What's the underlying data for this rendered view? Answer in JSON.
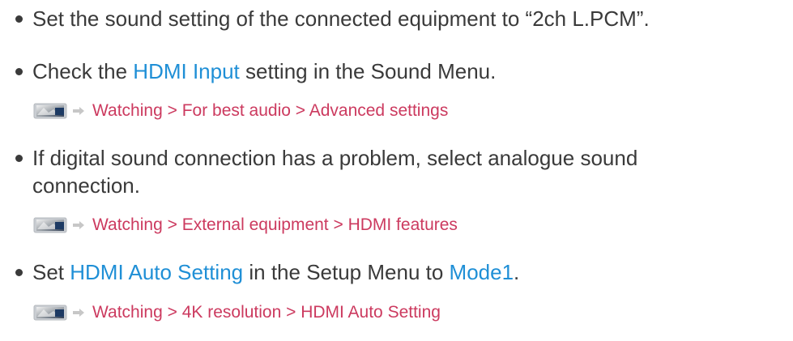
{
  "items": [
    {
      "text": "Set the sound setting of the connected equipment to “2ch L.PCM”."
    },
    {
      "prefix": "Check the ",
      "link": "HDMI Input",
      "suffix": " setting in the Sound Menu.",
      "ref": "Watching > For best audio > Advanced settings"
    },
    {
      "line1": "If digital sound connection has a problem, select analogue sound",
      "line2": "connection.",
      "ref": "Watching > External equipment > HDMI features"
    },
    {
      "prefix": "Set ",
      "link1": "HDMI Auto Setting",
      "middle": " in the Setup Menu to ",
      "link2": "Mode1",
      "suffix": ".",
      "ref": "Watching > 4K resolution > HDMI Auto Setting"
    }
  ],
  "colors": {
    "text": "#3a3a3a",
    "link": "#1f8fd6",
    "reference": "#cc3a5f"
  },
  "icons": {
    "reference": "ehelp-tv-icon",
    "arrow": "arrow-right-icon"
  }
}
